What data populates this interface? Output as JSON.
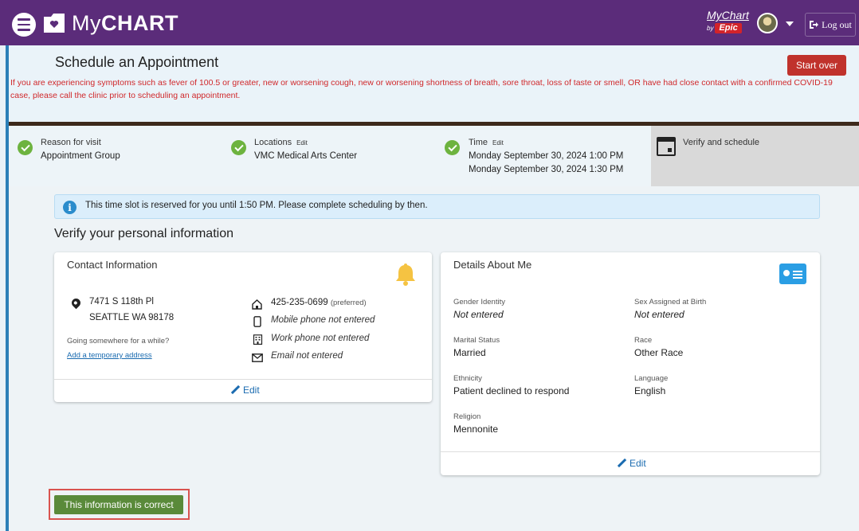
{
  "app": {
    "logo_text_prefix": "My",
    "logo_text_bold": "CHART",
    "brand_mychart": "MyChart",
    "brand_by": "by",
    "brand_epic": "Epic",
    "logout_label": "Log out"
  },
  "header": {
    "title": "Schedule an Appointment",
    "start_over_label": "Start over",
    "covid_notice": "If you are experiencing symptoms such as fever of 100.5 or greater, new or worsening cough, new or worsening shortness of breath, sore throat, loss of taste or smell, OR have had close contact with a confirmed COVID-19 case, please call the clinic prior to scheduling an appointment."
  },
  "steps": [
    {
      "label": "Reason for visit",
      "edit": "",
      "values": [
        "Appointment Group"
      ],
      "status": "complete"
    },
    {
      "label": "Locations",
      "edit": "Edit",
      "values": [
        "VMC Medical Arts Center"
      ],
      "status": "complete"
    },
    {
      "label": "Time",
      "edit": "Edit",
      "values": [
        "Monday September 30, 2024 1:00 PM",
        "Monday September 30, 2024 1:30 PM"
      ],
      "status": "complete"
    },
    {
      "label": "Verify and schedule",
      "edit": "",
      "values": [],
      "status": "current"
    }
  ],
  "banner": {
    "info_glyph": "i",
    "text": "This time slot is reserved for you until 1:50 PM. Please complete scheduling by then."
  },
  "verify_heading": "Verify your personal information",
  "contact": {
    "title": "Contact Information",
    "address_line1": "7471 S 118th Pl",
    "address_line2": "SEATTLE WA 98178",
    "going_somewhere": "Going somewhere for a while?",
    "temp_address_link": "Add a temporary address",
    "home_phone": "425-235-0699",
    "home_phone_note": "(preferred)",
    "mobile_phone": "Mobile phone not entered",
    "work_phone": "Work phone not entered",
    "email": "Email not entered",
    "edit_label": "Edit"
  },
  "details": {
    "title": "Details About Me",
    "fields": {
      "gender_identity": {
        "label": "Gender Identity",
        "value": "Not entered"
      },
      "sex_assigned": {
        "label": "Sex Assigned at Birth",
        "value": "Not entered"
      },
      "marital_status": {
        "label": "Marital Status",
        "value": "Married"
      },
      "race": {
        "label": "Race",
        "value": "Other Race"
      },
      "ethnicity": {
        "label": "Ethnicity",
        "value": "Patient declined to respond"
      },
      "language": {
        "label": "Language",
        "value": "English"
      },
      "religion": {
        "label": "Religion",
        "value": "Mennonite"
      }
    },
    "edit_label": "Edit"
  },
  "confirm_button_label": "This information is correct",
  "colors": {
    "topbar": "#5b2c7a",
    "accent_blue": "#2b7fb8",
    "start_over": "#c0322c",
    "covid_text": "#d0282b",
    "check_green": "#6db33f",
    "confirm_green": "#5a8a3a",
    "link_blue": "#1a6bb0"
  },
  "icons": {
    "menu": "hamburger-menu-icon",
    "logo": "mychart-logo-icon",
    "logout": "logout-icon",
    "check": "check-circle-icon",
    "calendar": "calendar-icon",
    "info": "info-circle-icon",
    "bell": "bell-icon",
    "id_card": "id-card-icon",
    "pin": "map-pin-icon",
    "home": "home-phone-icon",
    "mobile": "mobile-phone-icon",
    "work": "office-building-icon",
    "email": "envelope-icon",
    "pencil": "pencil-icon"
  }
}
